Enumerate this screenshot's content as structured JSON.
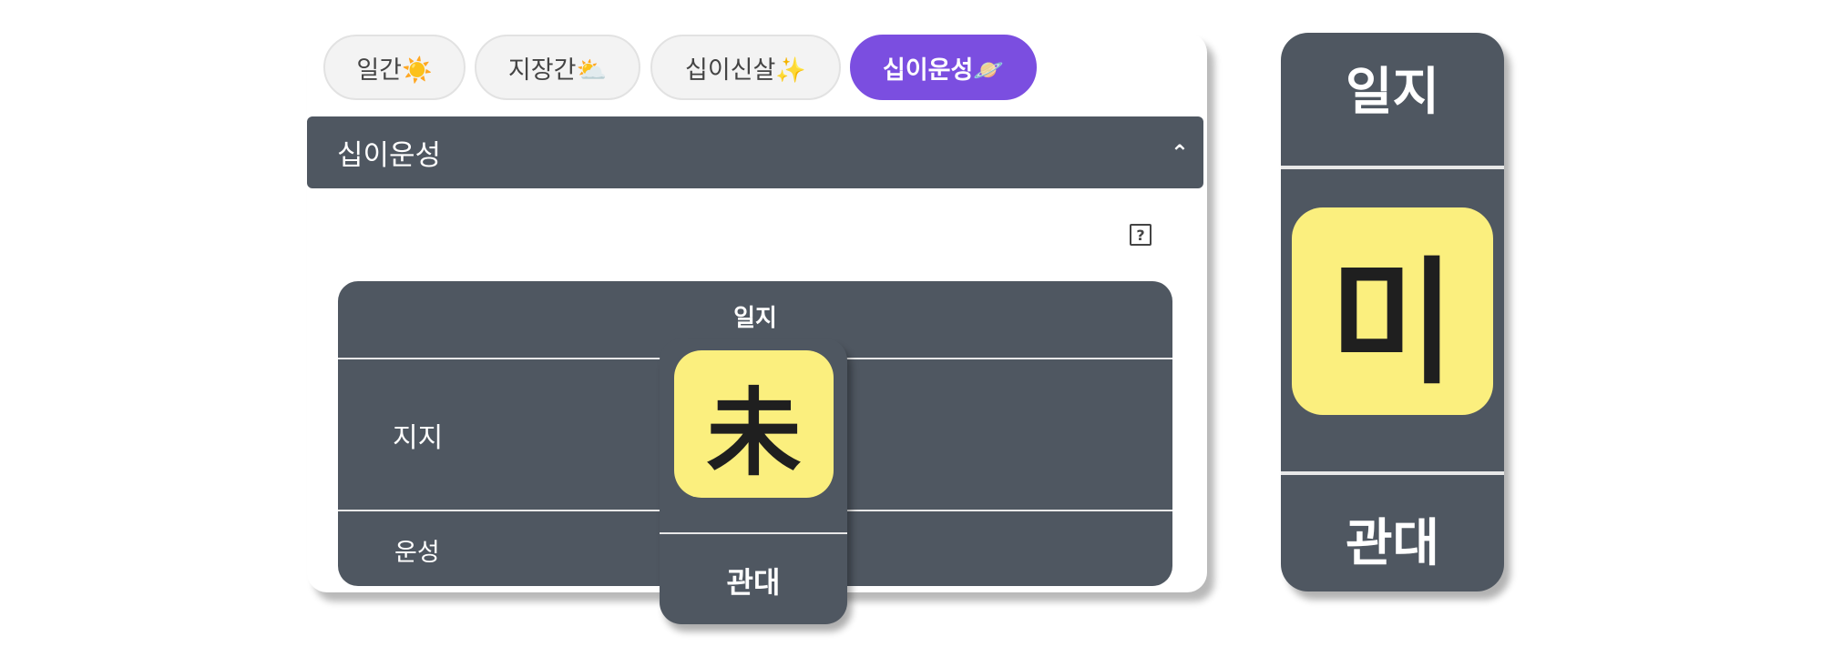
{
  "tabs": [
    {
      "label": "일간☀️"
    },
    {
      "label": "지장간⛅"
    },
    {
      "label": "십이신살✨"
    },
    {
      "label": "십이운성🪐"
    }
  ],
  "accordion": {
    "title": "십이운성",
    "chevron": "⌃"
  },
  "help": {
    "label": "?"
  },
  "table": {
    "column_header": "일지",
    "row_jiji": "지지",
    "row_unseong": "운성"
  },
  "popup": {
    "header": "일지",
    "char": "未",
    "value": "관대"
  },
  "side_card": {
    "header": "일지",
    "char": "미",
    "value": "관대"
  },
  "colors": {
    "accent": "#7b4ee0",
    "panel": "#4f5761",
    "highlight": "#fbef7e"
  }
}
